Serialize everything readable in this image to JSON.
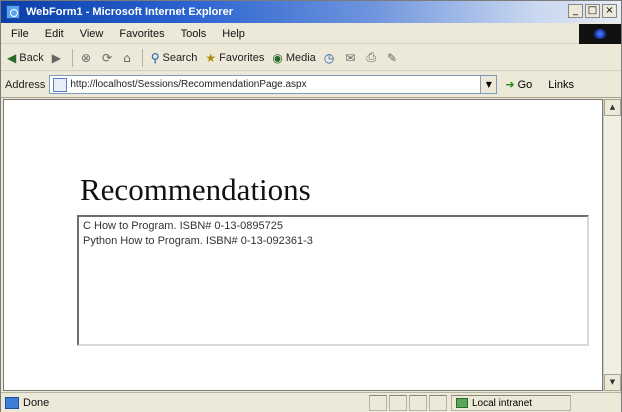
{
  "window": {
    "title": "WebForm1 - Microsoft Internet Explorer",
    "minimize": "_",
    "maximize": "□",
    "close": "×"
  },
  "menu": {
    "items": [
      "File",
      "Edit",
      "View",
      "Favorites",
      "Tools",
      "Help"
    ]
  },
  "toolbar": {
    "back": "Back",
    "search": "Search",
    "favorites": "Favorites",
    "media": "Media"
  },
  "address": {
    "label": "Address",
    "url": "http://localhost/Sessions/RecommendationPage.aspx",
    "go": "Go",
    "links": "Links"
  },
  "page": {
    "heading": "Recommendations",
    "recommendations": [
      "C How to Program. ISBN# 0-13-0895725",
      "Python How to Program. ISBN# 0-13-092361-3"
    ]
  },
  "status": {
    "text": "Done",
    "zone": "Local intranet"
  }
}
